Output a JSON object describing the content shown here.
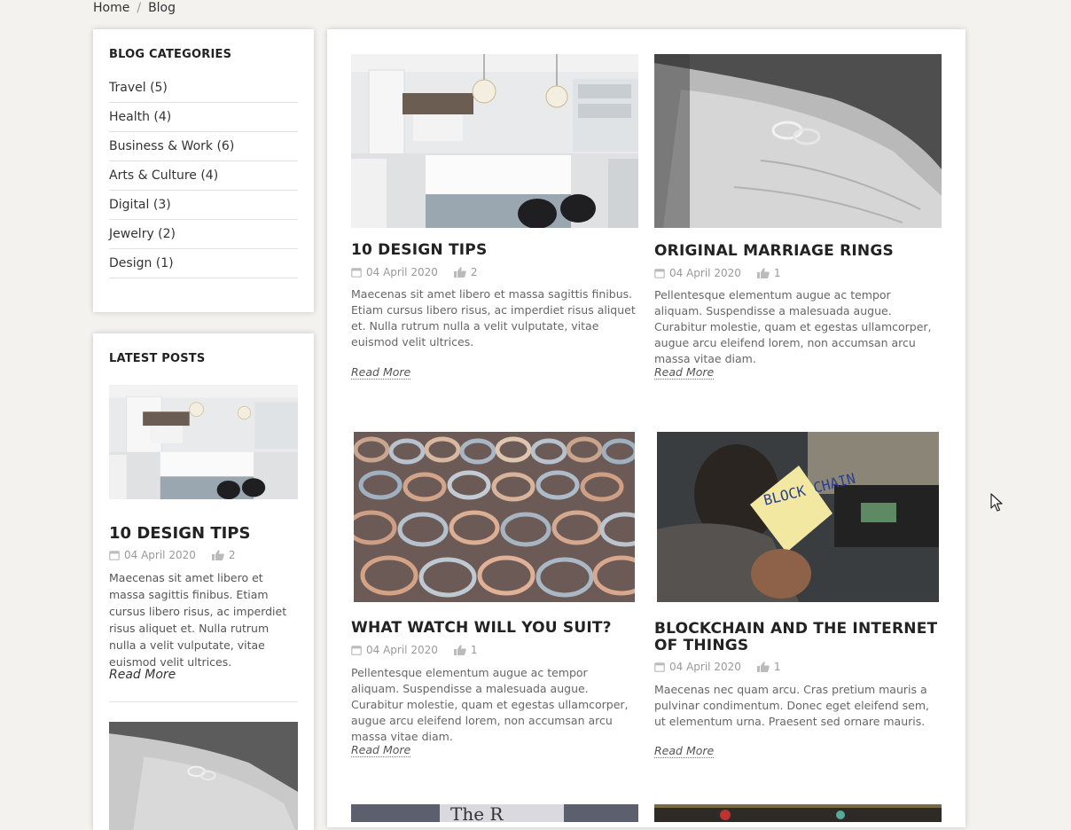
{
  "breadcrumb": {
    "home": "Home",
    "separator": "/",
    "current": "Blog"
  },
  "categories": {
    "title": "BLOG CATEGORIES",
    "items": [
      "Travel (5)",
      "Health (4)",
      "Business & Work (6)",
      "Arts & Culture (4)",
      "Digital (3)",
      "Jewelry (2)",
      "Design (1)"
    ]
  },
  "latest": {
    "title": "LATEST POSTS",
    "post": {
      "title": "10 DESIGN TIPS",
      "date": "04 April 2020",
      "likes": "2",
      "excerpt": "Maecenas sit amet libero et massa sagittis finibus. Etiam cursus libero risus, ac imperdiet risus aliquet et. Nulla rutrum nulla a velit vulputate, vitae euismod velit ultrices.",
      "read_more": "Read More"
    }
  },
  "posts": [
    {
      "title": "10 DESIGN TIPS",
      "date": "04 April 2020",
      "likes": "2",
      "excerpt": "Maecenas sit amet libero et massa sagittis finibus. Etiam cursus libero risus, ac imperdiet risus aliquet et. Nulla rutrum nulla a velit vulputate, vitae euismod velit ultrices.",
      "read_more": "Read More"
    },
    {
      "title": "ORIGINAL MARRIAGE RINGS",
      "date": "04 April 2020",
      "likes": "1",
      "excerpt": "Pellentesque elementum augue ac tempor aliquam. Suspendisse a malesuada augue. Curabitur molestie, quam et egestas ullamcorper, augue arcu eleifend lorem, non accumsan arcu massa vitae diam.",
      "read_more": "Read More"
    },
    {
      "title": "WHAT WATCH WILL YOU SUIT?",
      "date": "04 April 2020",
      "likes": "1",
      "excerpt": "Pellentesque elementum augue ac tempor aliquam. Suspendisse a malesuada augue. Curabitur molestie, quam et egestas ullamcorper, augue arcu eleifend lorem, non accumsan arcu massa vitae diam.",
      "read_more": "Read More"
    },
    {
      "title": "BLOCKCHAIN AND THE INTERNET OF THINGS",
      "date": "04 April 2020",
      "likes": "1",
      "excerpt": "Maecenas nec quam arcu. Cras pretium mauris a pulvinar condimentum. Donec eget eleifend sem, ut elementum urna. Praesent sed ornare mauris.",
      "read_more": "Read More"
    }
  ],
  "images": {
    "blockchain_note": "BLOCK CHAIN",
    "bottom_partial": "The R"
  },
  "icons": {
    "date": "calendar-icon",
    "likes": "thumbs-up-icon"
  },
  "colors": {
    "background": "#f3f2ef",
    "panel": "#ffffff",
    "text": "#222222",
    "muted": "#999999"
  }
}
